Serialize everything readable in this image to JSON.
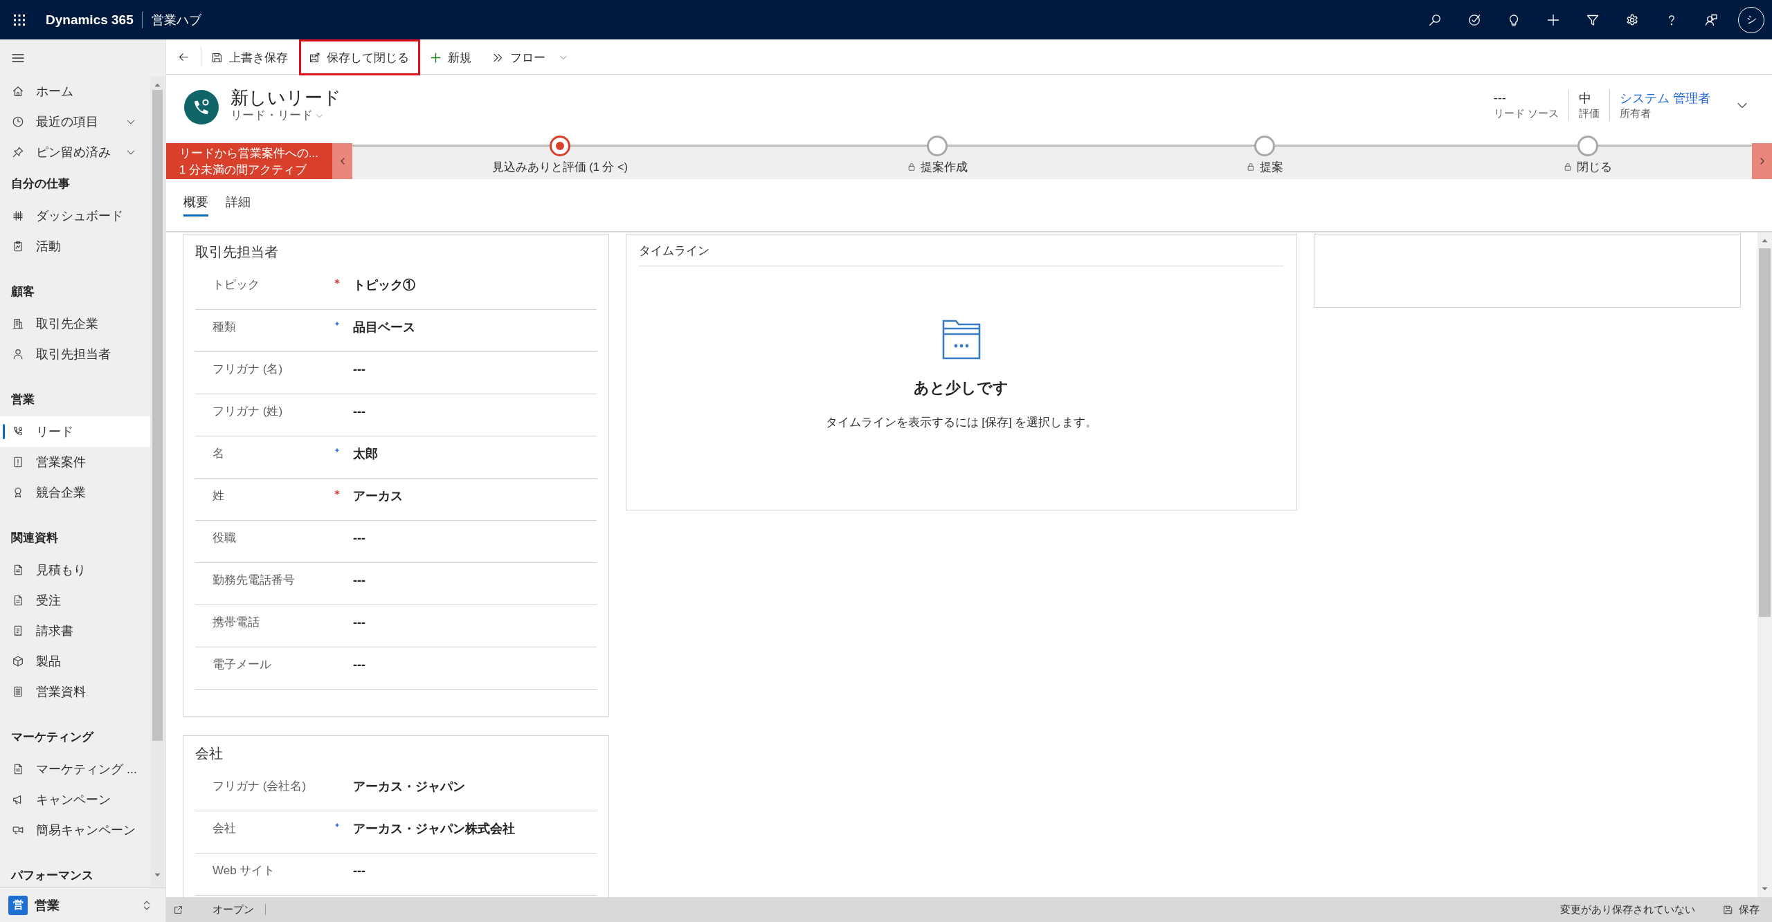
{
  "top_bar": {
    "brand": "Dynamics 365",
    "app_name": "営業ハブ",
    "avatar_initial": "シ"
  },
  "sidebar": {
    "items": [
      {
        "label": "ホーム",
        "kind": "link",
        "selected": false
      },
      {
        "label": "最近の項目",
        "kind": "menu",
        "selected": false
      },
      {
        "label": "ピン留め済み",
        "kind": "menu",
        "selected": false
      }
    ],
    "groups": [
      {
        "heading": "自分の仕事",
        "items": [
          {
            "label": "ダッシュボード",
            "selected": false
          },
          {
            "label": "活動",
            "selected": false
          }
        ]
      },
      {
        "heading": "顧客",
        "items": [
          {
            "label": "取引先企業",
            "selected": false
          },
          {
            "label": "取引先担当者",
            "selected": false
          }
        ]
      },
      {
        "heading": "営業",
        "items": [
          {
            "label": "リード",
            "selected": true
          },
          {
            "label": "営業案件",
            "selected": false
          },
          {
            "label": "競合企業",
            "selected": false
          }
        ]
      },
      {
        "heading": "関連資料",
        "items": [
          {
            "label": "見積もり",
            "selected": false
          },
          {
            "label": "受注",
            "selected": false
          },
          {
            "label": "請求書",
            "selected": false
          },
          {
            "label": "製品",
            "selected": false
          },
          {
            "label": "営業資料",
            "selected": false
          }
        ]
      },
      {
        "heading": "マーケティング",
        "items": [
          {
            "label": "マーケティング ...",
            "selected": false
          },
          {
            "label": "キャンペーン",
            "selected": false
          },
          {
            "label": "簡易キャンペーン",
            "selected": false
          }
        ]
      },
      {
        "heading": "パフォーマンス"
      }
    ]
  },
  "area_switcher": {
    "badge": "営",
    "label": "営業"
  },
  "command_bar": {
    "commands": [
      {
        "label": "上書き保存",
        "kind": "button",
        "highlighted": false
      },
      {
        "label": "保存して閉じる",
        "kind": "button",
        "highlighted": true
      },
      {
        "label": "新規",
        "kind": "button",
        "highlighted": false
      },
      {
        "label": "フロー",
        "kind": "dropdown",
        "highlighted": false
      }
    ]
  },
  "header": {
    "title": "新しいリード",
    "subtitle": "リード・リード",
    "fields": [
      {
        "value": "---",
        "label": "リード ソース",
        "kind": "text"
      },
      {
        "value": "中",
        "label": "評価",
        "kind": "text"
      },
      {
        "value": "システム 管理者",
        "label": "所有者",
        "kind": "link"
      }
    ]
  },
  "process": {
    "name": "リードから営業案件への...",
    "duration": "1 分未満の間アクティブ",
    "stages": [
      {
        "label": "見込みありと評価 (1 分 <)",
        "selected": true,
        "locked": false
      },
      {
        "label": "提案作成",
        "selected": false,
        "locked": true
      },
      {
        "label": "提案",
        "selected": false,
        "locked": true
      },
      {
        "label": "閉じる",
        "selected": false,
        "locked": true
      }
    ]
  },
  "tabs": [
    {
      "label": "概要",
      "selected": true
    },
    {
      "label": "詳細",
      "selected": false
    }
  ],
  "sections": [
    {
      "title": "取引先担当者",
      "fields": [
        {
          "label": "トピック",
          "required": true,
          "recommended": false,
          "value": "トピック①"
        },
        {
          "label": "種類",
          "required": false,
          "recommended": true,
          "value": "品目ベース"
        },
        {
          "label": "フリガナ (名)",
          "required": false,
          "recommended": false,
          "value": "---"
        },
        {
          "label": "フリガナ (姓)",
          "required": false,
          "recommended": false,
          "value": "---"
        },
        {
          "label": "名",
          "required": false,
          "recommended": true,
          "value": "太郎"
        },
        {
          "label": "姓",
          "required": true,
          "recommended": false,
          "value": "アーカス"
        },
        {
          "label": "役職",
          "required": false,
          "recommended": false,
          "value": "---"
        },
        {
          "label": "勤務先電話番号",
          "required": false,
          "recommended": false,
          "value": "---"
        },
        {
          "label": "携帯電話",
          "required": false,
          "recommended": false,
          "value": "---"
        },
        {
          "label": "電子メール",
          "required": false,
          "recommended": false,
          "value": "---"
        }
      ]
    },
    {
      "title": "会社",
      "fields": [
        {
          "label": "フリガナ (会社名)",
          "required": false,
          "recommended": false,
          "value": "アーカス・ジャパン"
        },
        {
          "label": "会社",
          "required": false,
          "recommended": true,
          "value": "アーカス・ジャパン株式会社"
        },
        {
          "label": "Web サイト",
          "required": false,
          "recommended": false,
          "value": "---"
        }
      ]
    }
  ],
  "timeline": {
    "title": "タイムライン",
    "empty_title": "あと少しです",
    "empty_message": "タイムラインを表示するには [保存] を選択します。"
  },
  "status_bar": {
    "status": "オープン",
    "unsaved_notice": "変更があり保存されていない",
    "save_label": "保存"
  }
}
